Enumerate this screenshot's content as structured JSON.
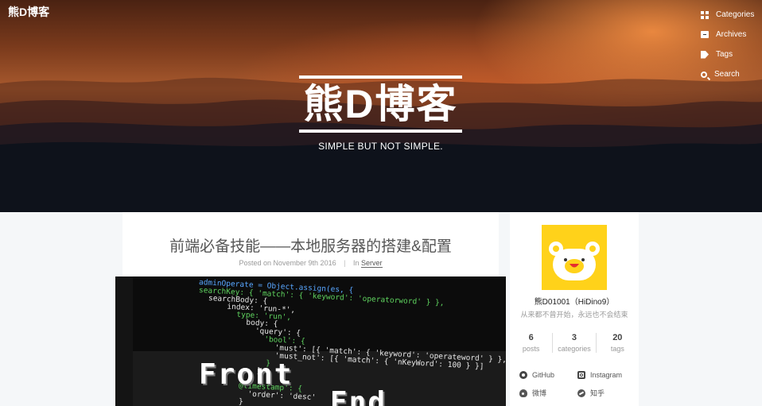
{
  "site": {
    "logo": "熊D博客",
    "title": "熊D博客",
    "subtitle": "SIMPLE BUT NOT SIMPLE."
  },
  "nav": {
    "items": [
      {
        "label": "Categories",
        "icon": "grid-icon"
      },
      {
        "label": "Archives",
        "icon": "archive-icon"
      },
      {
        "label": "Tags",
        "icon": "tag-icon"
      },
      {
        "label": "Search",
        "icon": "search-icon"
      }
    ]
  },
  "post": {
    "title": "前端必备技能——本地服务器的搭建&配置",
    "posted_prefix": "Posted on",
    "date": "November 9th 2016",
    "separator": "|",
    "in_prefix": "In",
    "category": "Server",
    "image_front": "Front",
    "image_end": "End",
    "code_lines": [
      "adminOperate = Object.assign(es, {",
      "searchKey: { 'match': { 'keyword': 'operatorword' } },",
      "searchBody: {",
      "  index: 'run-*',",
      "  type: 'run',",
      "  body: {",
      "    'query': {",
      "      'bool': {",
      "        'must': [{ 'match': { 'keyword': 'operateword' } },",
      "        'must_not': [{ 'match': { 'nKeyWord': 100 } }]",
      "      }",
      "    }",
      "  }",
      "@timestamp': {",
      "  'order': 'desc'",
      "}"
    ]
  },
  "sidebar": {
    "author_name": "熊D01001（HiDino9）",
    "author_desc": "从来都不曾开始，永远也不会结束",
    "stats": [
      {
        "count": "6",
        "label": "posts"
      },
      {
        "count": "3",
        "label": "categories"
      },
      {
        "count": "20",
        "label": "tags"
      }
    ],
    "links": [
      {
        "label": "GitHub",
        "icon": "github-icon"
      },
      {
        "label": "Instagram",
        "icon": "instagram-icon"
      },
      {
        "label": "微博",
        "icon": "weibo-icon"
      },
      {
        "label": "知乎",
        "icon": "zhihu-icon"
      }
    ]
  },
  "colors": {
    "avatar_bg": "#ffd21a",
    "page_bg": "#f5f7f9"
  }
}
